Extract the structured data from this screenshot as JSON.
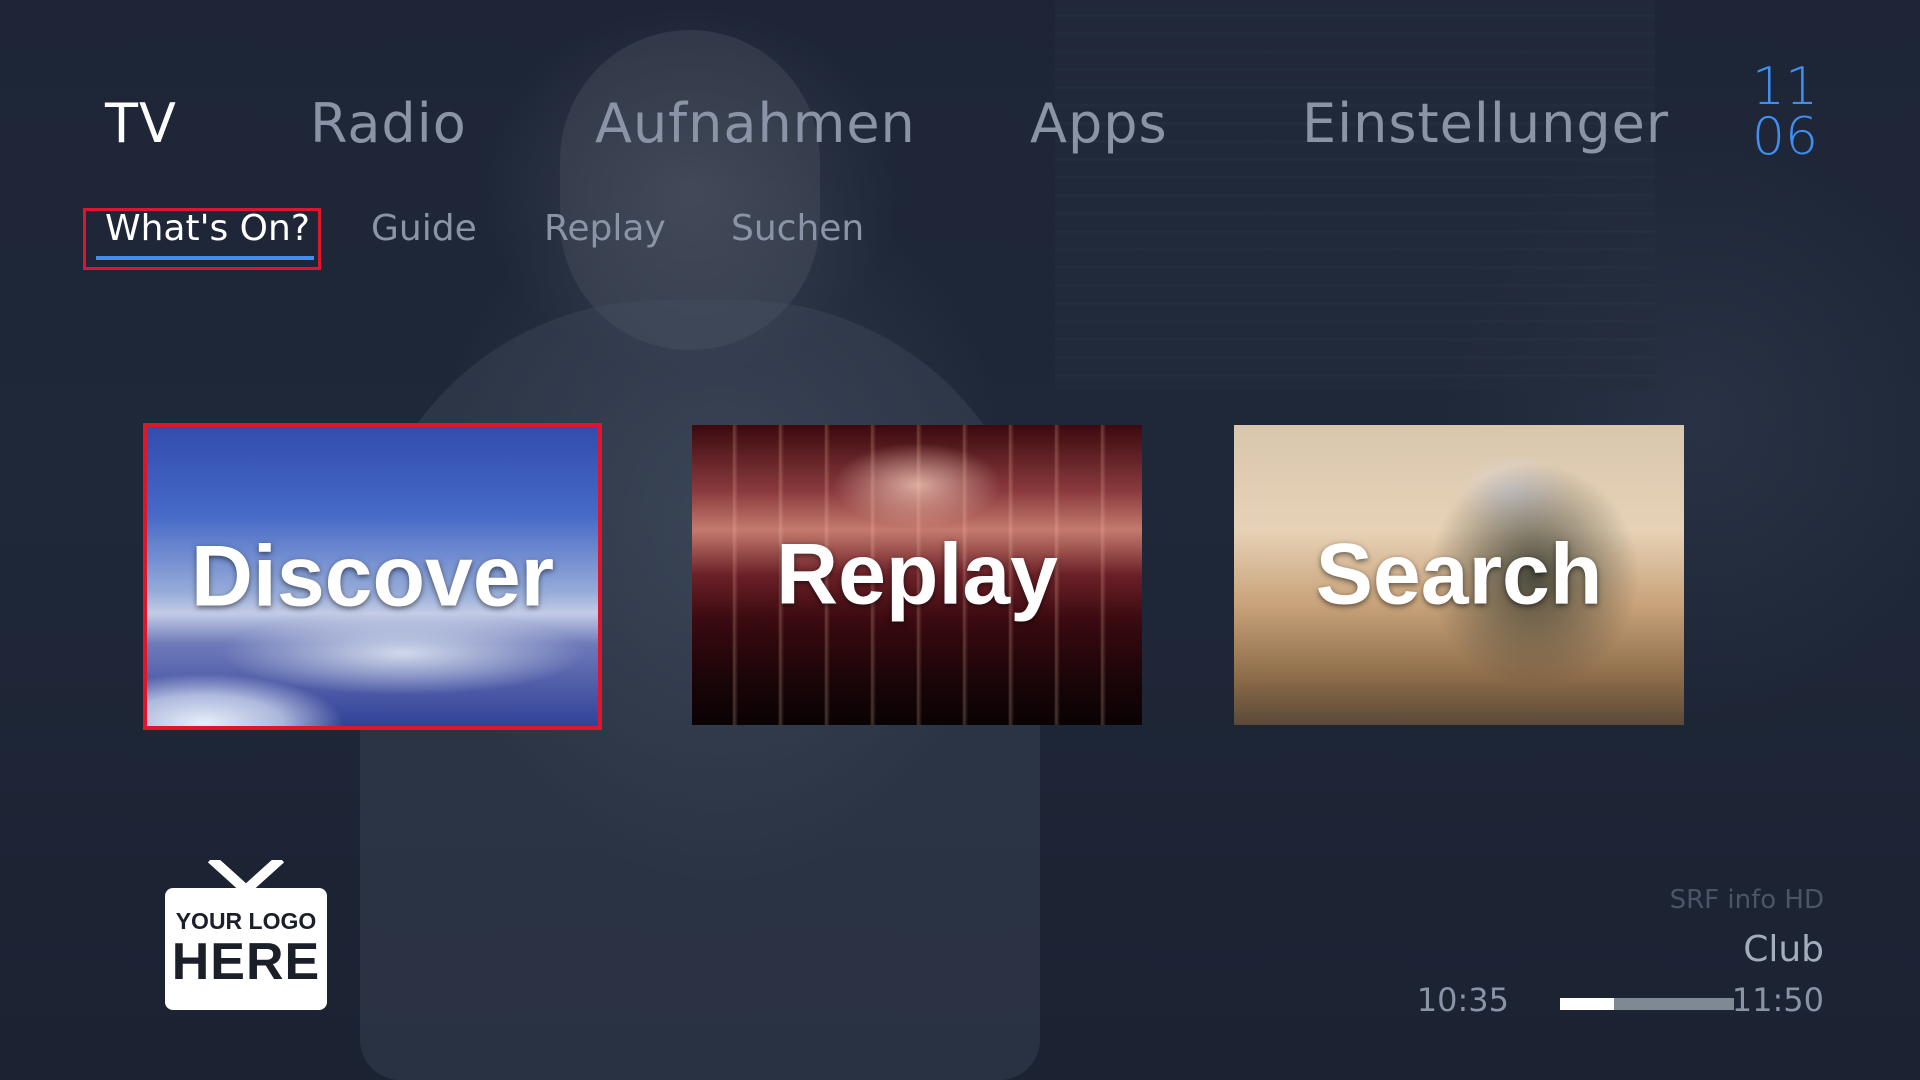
{
  "main_nav": {
    "items": [
      {
        "label": "TV",
        "active": true
      },
      {
        "label": "Radio",
        "active": false
      },
      {
        "label": "Aufnahmen",
        "active": false
      },
      {
        "label": "Apps",
        "active": false
      },
      {
        "label": "Einstellunger",
        "active": false
      }
    ]
  },
  "clock": {
    "hour": "11",
    "minute": "06"
  },
  "sub_nav": {
    "items": [
      {
        "label": "What's On?",
        "active": true
      },
      {
        "label": "Guide",
        "active": false
      },
      {
        "label": "Replay",
        "active": false
      },
      {
        "label": "Suchen",
        "active": false
      }
    ]
  },
  "tiles": [
    {
      "label": "Discover",
      "focused": true
    },
    {
      "label": "Replay",
      "focused": false
    },
    {
      "label": "Search",
      "focused": false
    }
  ],
  "logo": {
    "line1": "YOUR LOGO",
    "line2": "HERE"
  },
  "now_playing": {
    "channel": "SRF info HD",
    "title": "Club",
    "start_time": "10:35",
    "end_time": "11:50",
    "progress": 0.31
  },
  "colors": {
    "accent": "#3f8ef0",
    "focus": "#e0152b",
    "text_active": "#ffffff",
    "text_inactive": "#8a94a6"
  }
}
